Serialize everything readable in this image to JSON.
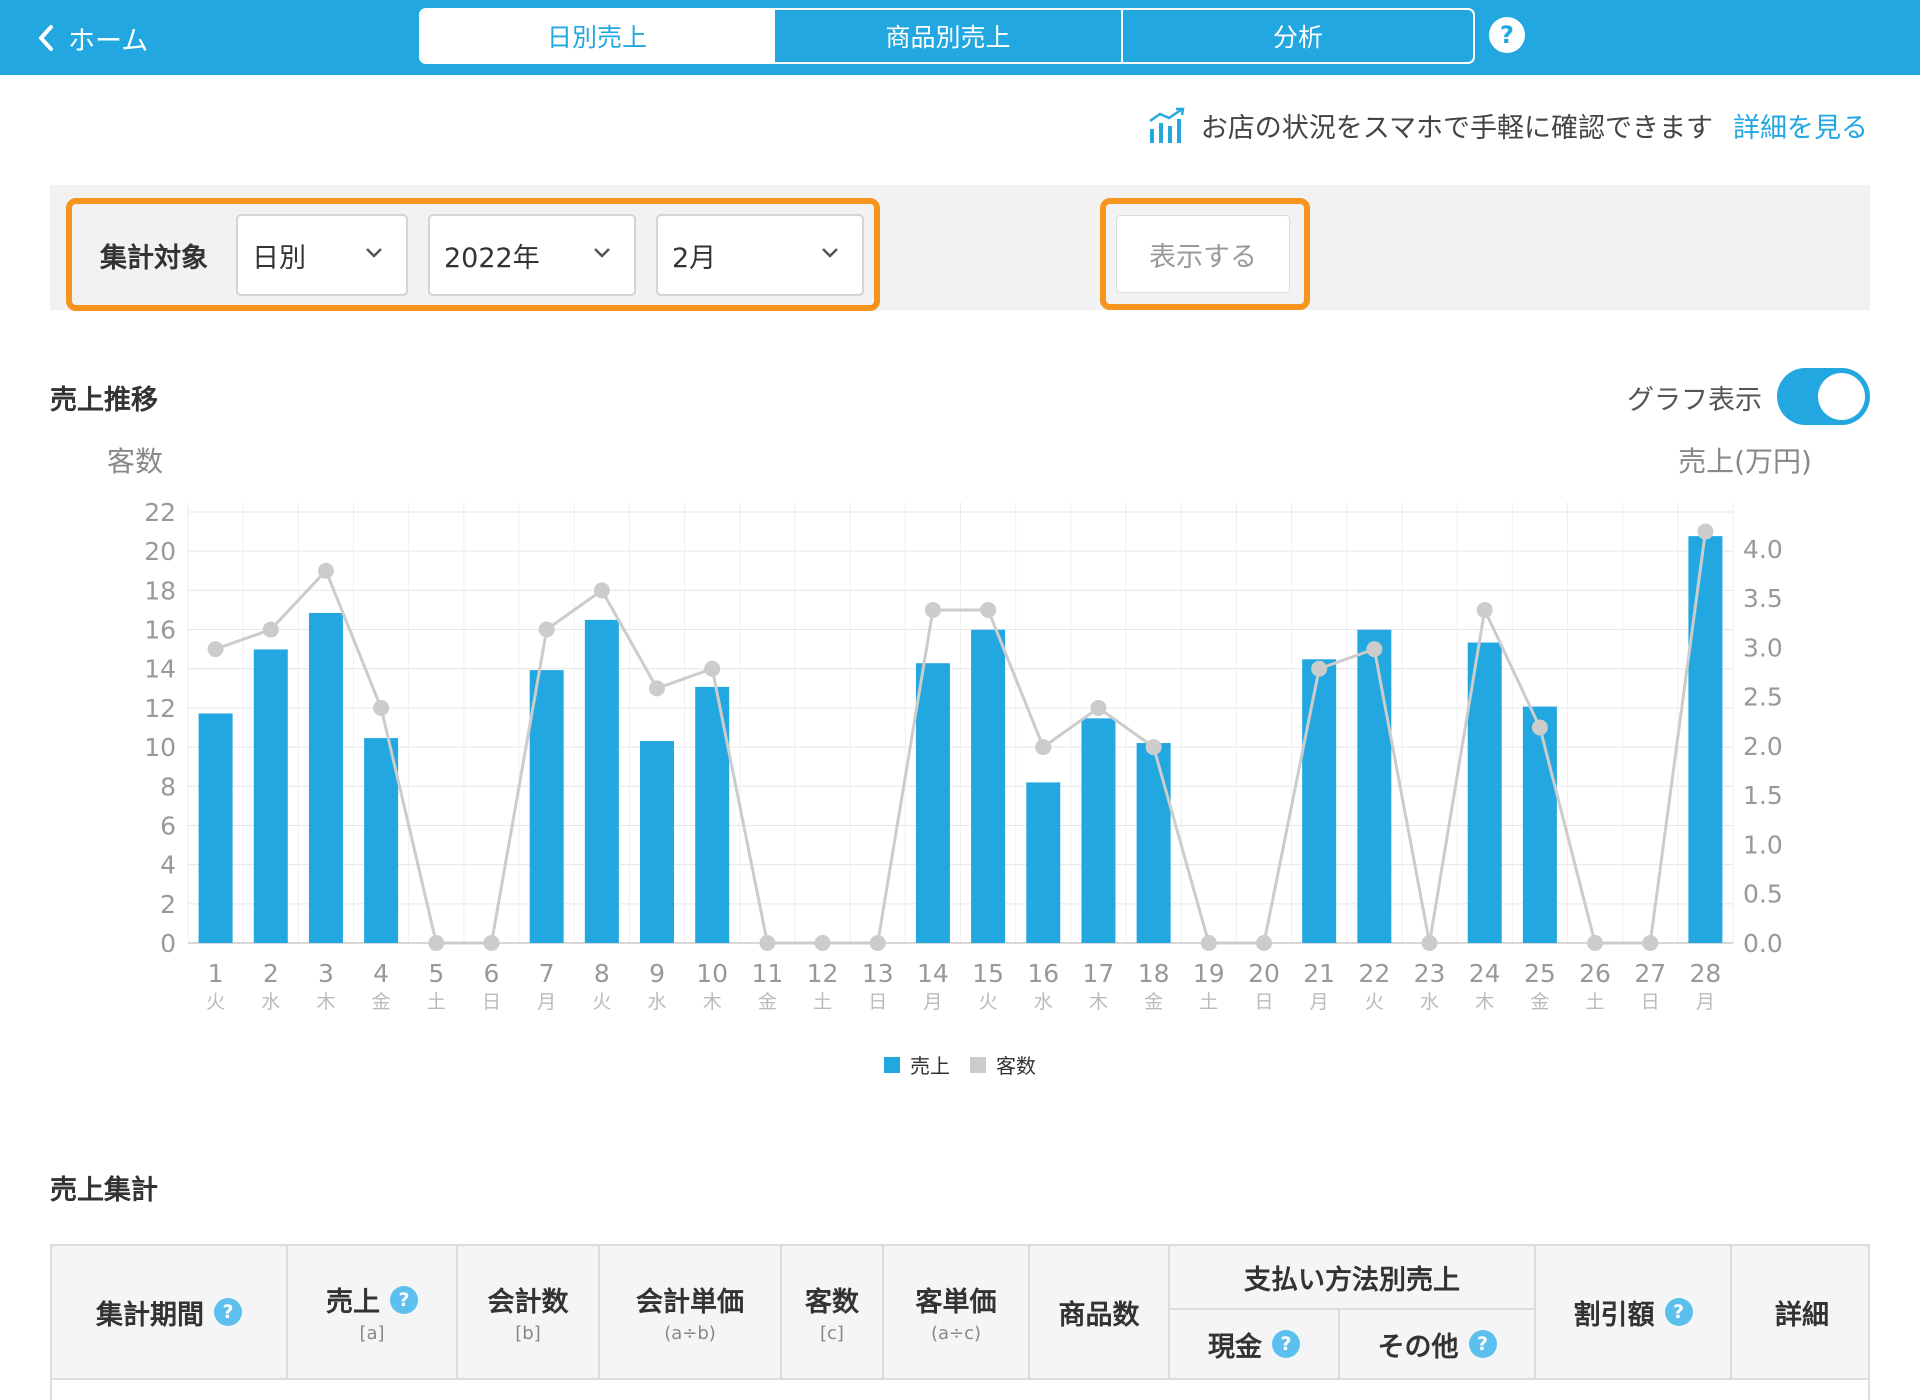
{
  "header": {
    "back_label": "ホーム",
    "tabs": [
      {
        "label": "日別売上",
        "active": true
      },
      {
        "label": "商品別売上",
        "active": false
      },
      {
        "label": "分析",
        "active": false
      }
    ],
    "help": "?"
  },
  "promo": {
    "text": "お店の状況をスマホで手軽に確認できます",
    "link": "詳細を見る"
  },
  "filter": {
    "label": "集計対象",
    "period_type": "日別",
    "year": "2022年",
    "month": "2月",
    "show_button": "表示する"
  },
  "chart_section": {
    "title": "売上推移",
    "toggle_label": "グラフ表示",
    "toggle_on": true
  },
  "chart_data": {
    "type": "bar",
    "ylabel_left": "客数",
    "ylabel_right": "売上(万円)",
    "y_left_ticks": [
      "0",
      "2",
      "4",
      "6",
      "8",
      "10",
      "12",
      "14",
      "16",
      "18",
      "20",
      "22"
    ],
    "y_left_range": [
      0,
      22
    ],
    "y_right_ticks": [
      "0.0",
      "0.5",
      "1.0",
      "1.5",
      "2.0",
      "2.5",
      "3.0",
      "3.5",
      "4.0"
    ],
    "y_right_range": [
      0,
      4.375
    ],
    "categories": [
      "1",
      "2",
      "3",
      "4",
      "5",
      "6",
      "7",
      "8",
      "9",
      "10",
      "11",
      "12",
      "13",
      "14",
      "15",
      "16",
      "17",
      "18",
      "19",
      "20",
      "21",
      "22",
      "23",
      "24",
      "25",
      "26",
      "27",
      "28"
    ],
    "weekdays": [
      "火",
      "水",
      "木",
      "金",
      "土",
      "日",
      "月",
      "火",
      "水",
      "木",
      "金",
      "土",
      "日",
      "月",
      "火",
      "水",
      "木",
      "金",
      "土",
      "日",
      "月",
      "火",
      "水",
      "木",
      "金",
      "土",
      "日",
      "月"
    ],
    "series": [
      {
        "name": "売上",
        "type": "bar",
        "axis": "right",
        "color": "#22a7e0",
        "values": [
          2.33,
          2.98,
          3.35,
          2.08,
          0,
          0,
          2.77,
          3.28,
          2.05,
          2.6,
          0,
          0,
          0,
          2.84,
          3.18,
          1.63,
          2.28,
          2.03,
          0,
          0,
          2.88,
          3.18,
          0,
          3.05,
          2.4,
          0,
          0,
          4.13
        ]
      },
      {
        "name": "客数",
        "type": "line",
        "axis": "left",
        "color": "#cccccc",
        "values": [
          15,
          16,
          19,
          12,
          0,
          0,
          16,
          18,
          13,
          14,
          0,
          0,
          0,
          17,
          17,
          10,
          12,
          10,
          0,
          0,
          14,
          15,
          0,
          17,
          11,
          0,
          0,
          21
        ]
      }
    ],
    "legend": [
      "売上",
      "客数"
    ],
    "legend_position": "bottom-center",
    "grid": true
  },
  "summary_section": {
    "title": "売上集計"
  },
  "table": {
    "columns": [
      {
        "label": "集計期間",
        "sub": "",
        "help": true
      },
      {
        "label": "売上",
        "sub": "[a]",
        "help": true
      },
      {
        "label": "会計数",
        "sub": "[b]",
        "help": false
      },
      {
        "label": "会計単価",
        "sub": "(a÷b)",
        "help": false
      },
      {
        "label": "客数",
        "sub": "[c]",
        "help": false
      },
      {
        "label": "客単価",
        "sub": "(a÷c)",
        "help": false
      },
      {
        "label": "商品数",
        "sub": "",
        "help": false
      },
      {
        "label": "割引額",
        "sub": "",
        "help": true
      },
      {
        "label": "詳細",
        "sub": "",
        "help": false
      }
    ],
    "payment_group": {
      "label": "支払い方法別売上",
      "cash": "現金",
      "other": "その他"
    }
  }
}
